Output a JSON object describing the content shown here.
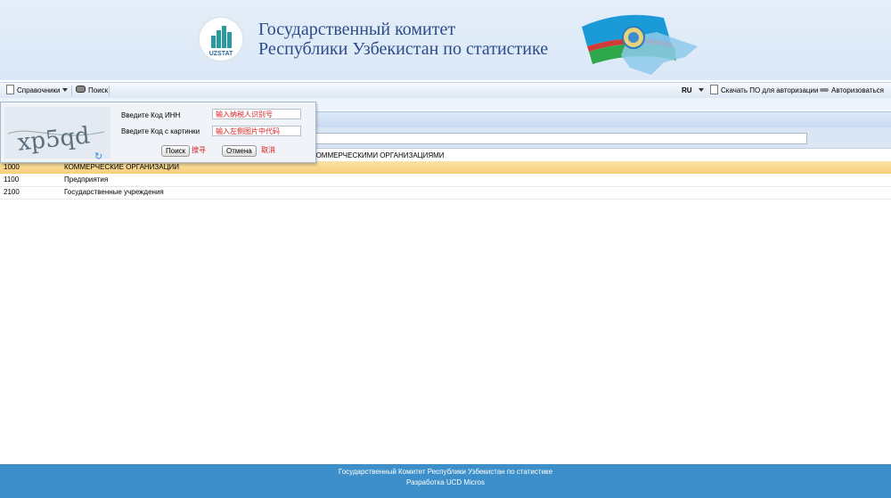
{
  "header": {
    "logo_text": "UZSTAT",
    "title_line1": "Государственный комитет",
    "title_line2": "Республики Узбекистан по статистике"
  },
  "toolbar": {
    "directory_label": "Справочники",
    "search_label": "Поиск",
    "language": "RU",
    "download_label": "Скачать ПО для авторизации",
    "login_label": "Авторизоваться"
  },
  "search_popup": {
    "captcha_text": "xp5qd",
    "inn_label": "Введите Код ИНН",
    "inn_placeholder": "输入纳税人识别号",
    "captcha_label": "Введите Код с картинки",
    "captcha_placeholder": "输入左侧图片中代码",
    "search_button": "Поиск",
    "search_hint": "搜寻",
    "cancel_button": "Отмена",
    "cancel_hint": "取消"
  },
  "table": {
    "caption": "КОММЕРЧЕСКИМИ ОРГАНИЗАЦИЯМИ",
    "rows": [
      {
        "code": "1000",
        "name": "КОММЕРЧЕСКИЕ ОРГАНИЗАЦИИ"
      },
      {
        "code": "1100",
        "name": "Предприятия"
      },
      {
        "code": "2100",
        "name": "Государственные учреждения"
      }
    ]
  },
  "footer": {
    "line1": "Государственный Комитет Республики Узбекистан по статистике",
    "line2": "Разработка UCD Micros"
  },
  "colors": {
    "header_bg": "#dbe8f7",
    "title_blue": "#2b4c88",
    "selected_row": "#f6cd7a",
    "footer_bg": "#3d8fca",
    "hint_red": "#d62020"
  }
}
